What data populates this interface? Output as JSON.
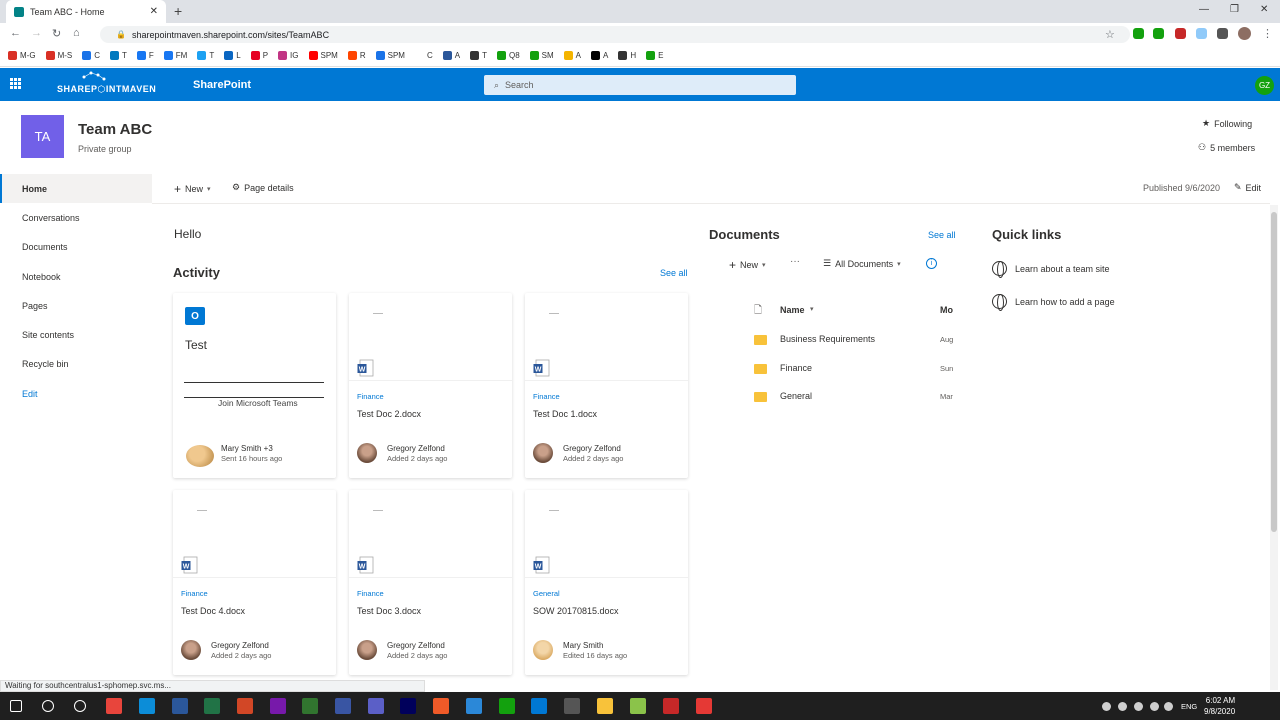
{
  "browser": {
    "tab_title": "Team ABC - Home",
    "url": "sharepointmaven.sharepoint.com/sites/TeamABC",
    "bookmarks": [
      {
        "label": "M-G",
        "color": "#d93025"
      },
      {
        "label": "M-S",
        "color": "#d93025"
      },
      {
        "label": "C",
        "color": "#1a73e8"
      },
      {
        "label": "T",
        "color": "#0079bf"
      },
      {
        "label": "F",
        "color": "#1877f2"
      },
      {
        "label": "FM",
        "color": "#1877f2"
      },
      {
        "label": "T",
        "color": "#1da1f2"
      },
      {
        "label": "L",
        "color": "#0a66c2"
      },
      {
        "label": "P",
        "color": "#e60023"
      },
      {
        "label": "IG",
        "color": "#c13584"
      },
      {
        "label": "SPM",
        "color": "#ff0000"
      },
      {
        "label": "R",
        "color": "#ff4500"
      },
      {
        "label": "SPM",
        "color": "#1a73e8"
      },
      {
        "label": "C",
        "color": "#ffffff"
      },
      {
        "label": "A",
        "color": "#2b579a"
      },
      {
        "label": "T",
        "color": "#333333"
      },
      {
        "label": "Q8",
        "color": "#13a10e"
      },
      {
        "label": "SM",
        "color": "#13a10e"
      },
      {
        "label": "A",
        "color": "#f4b400"
      },
      {
        "label": "A",
        "color": "#000000"
      },
      {
        "label": "H",
        "color": "#333333"
      },
      {
        "label": "E",
        "color": "#13a10e"
      }
    ]
  },
  "suite": {
    "app_name": "SharePoint",
    "search_placeholder": "Search",
    "user_initials": "GZ",
    "logo_text": "SHAREP⬡INTMAVEN"
  },
  "site": {
    "logo_initials": "TA",
    "title": "Team ABC",
    "subtitle": "Private group",
    "following_label": "Following",
    "members_label": "5 members"
  },
  "nav": {
    "items": [
      "Home",
      "Conversations",
      "Documents",
      "Notebook",
      "Pages",
      "Site contents",
      "Recycle bin"
    ],
    "edit_label": "Edit"
  },
  "command": {
    "new_label": "New",
    "page_details_label": "Page details",
    "published": "Published 9/6/2020",
    "edit_label": "Edit"
  },
  "main": {
    "hello": "Hello",
    "activity_title": "Activity",
    "see_all": "See all",
    "cards": [
      {
        "kind": "outlook",
        "title": "Test",
        "join_text": "Join Microsoft Teams",
        "person": "Mary Smith +3",
        "meta": "Sent 16 hours ago"
      },
      {
        "kind": "doc",
        "category": "Finance",
        "name": "Test Doc 2.docx",
        "person": "Gregory Zelfond",
        "meta": "Added 2 days ago"
      },
      {
        "kind": "doc",
        "category": "Finance",
        "name": "Test Doc 1.docx",
        "person": "Gregory Zelfond",
        "meta": "Added 2 days ago"
      },
      {
        "kind": "doc",
        "category": "Finance",
        "name": "Test Doc 4.docx",
        "person": "Gregory Zelfond",
        "meta": "Added 2 days ago"
      },
      {
        "kind": "doc",
        "category": "Finance",
        "name": "Test Doc 3.docx",
        "person": "Gregory Zelfond",
        "meta": "Added 2 days ago"
      },
      {
        "kind": "doc",
        "category": "General",
        "name": "SOW 20170815.docx",
        "person": "Mary Smith",
        "meta": "Edited 16 days ago"
      }
    ]
  },
  "documents": {
    "title": "Documents",
    "see_all": "See all",
    "new_label": "New",
    "more_label": "···",
    "view_label": "All Documents",
    "col_name": "Name",
    "col_modified": "Mo",
    "rows": [
      {
        "name": "Business Requirements",
        "modified": "Aug"
      },
      {
        "name": "Finance",
        "modified": "Sun"
      },
      {
        "name": "General",
        "modified": "Mar"
      }
    ]
  },
  "quick_links": {
    "title": "Quick links",
    "items": [
      "Learn about a team site",
      "Learn how to add a page"
    ]
  },
  "status_text": "Waiting for southcentralus1-sphomep.svc.ms...",
  "taskbar": {
    "time": "6:02 AM",
    "date": "9/8/2020",
    "lang": "ENG"
  },
  "colors": {
    "suite_blue": "#0078d4",
    "site_logo": "#7160e8",
    "link": "#0078d4",
    "folder": "#f8c23a"
  }
}
